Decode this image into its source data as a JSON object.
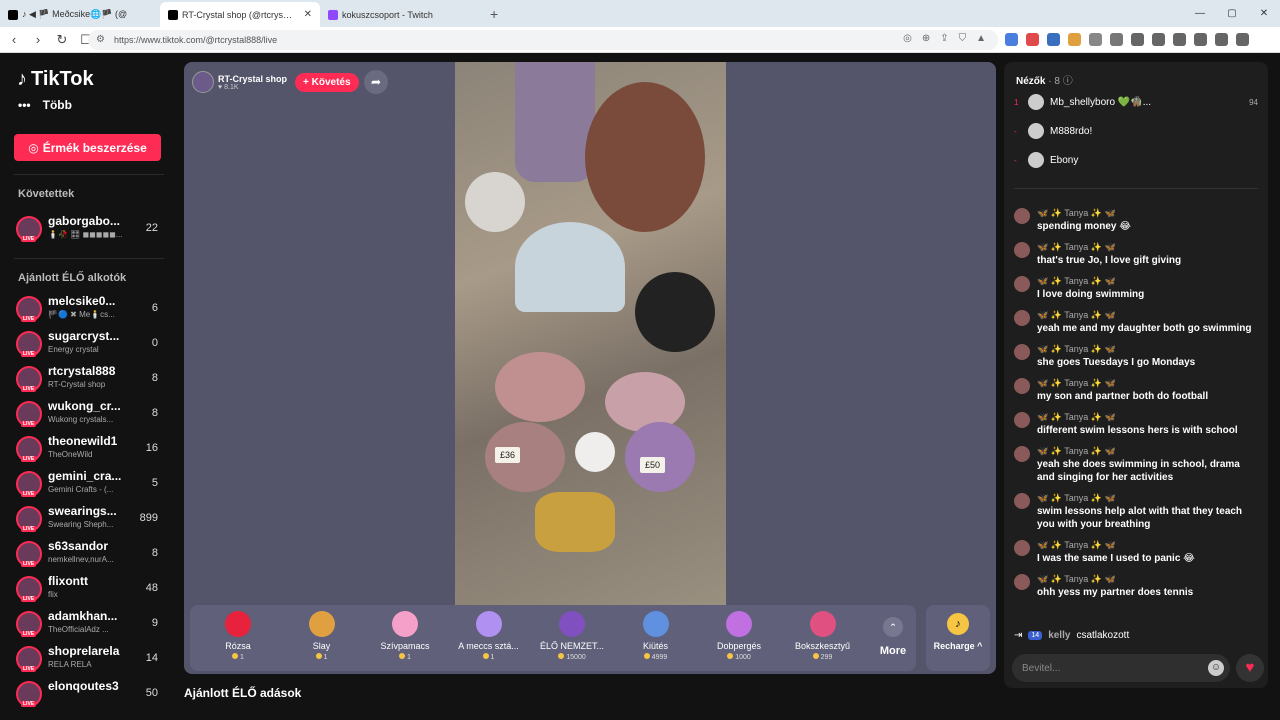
{
  "browser": {
    "tabs": [
      {
        "title": "♪ ◀ 🏴 Meðcsike🌐🏴 (@"
      },
      {
        "title": "RT-Crystal shop (@rtcrystal88"
      },
      {
        "title": "kokuszcsoport - Twitch"
      }
    ],
    "url": "https://www.tiktok.com/@rtcrystal888/live"
  },
  "sidebar": {
    "logo": "TikTok",
    "more": "Több",
    "coins_button": "Érmék beszerzése",
    "following_title": "Követettek",
    "following": [
      {
        "name": "gaborgabo...",
        "sub": "🕯️🥀 🎛 ◼◼◼◼◼...",
        "count": "22"
      }
    ],
    "recommended_title": "Ajánlott ÉLŐ alkotók",
    "creators": [
      {
        "name": "melcsike0...",
        "sub": "🏴🔵 ✖ Me🕯️cs...",
        "count": "6"
      },
      {
        "name": "sugarcryst...",
        "sub": "Energy crystal",
        "count": "0"
      },
      {
        "name": "rtcrystal888",
        "sub": "RT-Crystal shop",
        "count": "8"
      },
      {
        "name": "wukong_cr...",
        "sub": "Wukong crystals...",
        "count": "8"
      },
      {
        "name": "theonewild1",
        "sub": "TheOneWild",
        "count": "16"
      },
      {
        "name": "gemini_cra...",
        "sub": "Gemini Crafts - (...",
        "count": "5"
      },
      {
        "name": "swearings...",
        "sub": "Swearing Sheph...",
        "count": "899"
      },
      {
        "name": "s63sandor",
        "sub": "nemkellnev,nurA...",
        "count": "8"
      },
      {
        "name": "flixontt",
        "sub": "flix",
        "count": "48"
      },
      {
        "name": "adamkhan...",
        "sub": "TheOfficialAdz ...",
        "count": "9"
      },
      {
        "name": "shoprelarela",
        "sub": "RELA RELA",
        "count": "14"
      },
      {
        "name": "elonqoutes3",
        "sub": "",
        "count": "50"
      }
    ]
  },
  "stage": {
    "host_name": "RT-Crystal shop",
    "host_likes": "8.1K",
    "follow": "+ Követés",
    "price_tags": [
      "£36",
      "£50"
    ],
    "gifts": [
      {
        "name": "Rózsa",
        "price": "1",
        "color": "#e8223c"
      },
      {
        "name": "Slay",
        "price": "1",
        "color": "#e0a040"
      },
      {
        "name": "Szívpamacs",
        "price": "1",
        "color": "#f5a0c8"
      },
      {
        "name": "A meccs sztá...",
        "price": "1",
        "color": "#b090f0"
      },
      {
        "name": "ÉLŐ NEMZET...",
        "price": "15000",
        "color": "#8050c0"
      },
      {
        "name": "Kiütés",
        "price": "4999",
        "color": "#6090e0"
      },
      {
        "name": "Dobpergés",
        "price": "1000",
        "color": "#c070e0"
      },
      {
        "name": "Bokszkesztyű",
        "price": "299",
        "color": "#e05080"
      }
    ],
    "more": "More",
    "recharge": "Recharge ^"
  },
  "bottom_title": "Ajánlott ÉLŐ adások",
  "chat": {
    "viewers_title": "Nézők",
    "viewers_count": "· 8",
    "viewers": [
      {
        "rank": "1",
        "name": "Mb_shellyboro 💚🧌...",
        "score": "94"
      },
      {
        "rank": "-",
        "name": "M888rdo!",
        "score": ""
      },
      {
        "rank": "-",
        "name": "Ebony",
        "score": ""
      }
    ],
    "messages": [
      {
        "user": "🦋 ✨ Tanya ✨ 🦋",
        "text": "spending money 😂"
      },
      {
        "user": "🦋 ✨ Tanya ✨ 🦋",
        "text": "that's true Jo, I love gift giving"
      },
      {
        "user": "🦋 ✨ Tanya ✨ 🦋",
        "text": "I love doing swimming"
      },
      {
        "user": "🦋 ✨ Tanya ✨ 🦋",
        "text": "yeah me and my daughter both go swimming"
      },
      {
        "user": "🦋 ✨ Tanya ✨ 🦋",
        "text": "she goes Tuesdays I go Mondays"
      },
      {
        "user": "🦋 ✨ Tanya ✨ 🦋",
        "text": "my son and partner both do football"
      },
      {
        "user": "🦋 ✨ Tanya ✨ 🦋",
        "text": "different swim lessons hers is with school"
      },
      {
        "user": "🦋 ✨ Tanya ✨ 🦋",
        "text": "yeah she does swimming in school, drama and singing for her activities"
      },
      {
        "user": "🦋 ✨ Tanya ✨ 🦋",
        "text": "swim lessons help alot with that they teach you with your breathing"
      },
      {
        "user": "🦋 ✨ Tanya ✨ 🦋",
        "text": "I was the same I used to panic 😂"
      },
      {
        "user": "🦋 ✨ Tanya ✨ 🦋",
        "text": "ohh yess my partner does tennis"
      }
    ],
    "joined_level": "14",
    "joined_user": "kelly",
    "joined_text": "csatlakozott",
    "input_placeholder": "Bevitel..."
  }
}
